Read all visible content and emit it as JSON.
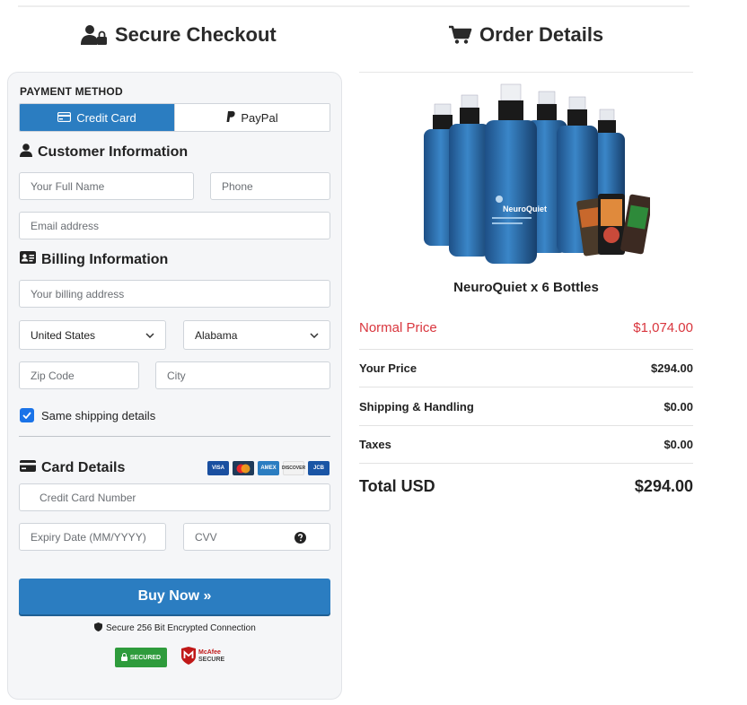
{
  "checkout": {
    "title": "Secure Checkout",
    "payment_method_label": "PAYMENT METHOD",
    "tabs": [
      {
        "label": "Credit Card",
        "icon": "credit-card-icon",
        "active": true
      },
      {
        "label": "PayPal",
        "icon": "paypal-icon",
        "active": false
      }
    ],
    "customer_section": {
      "title": "Customer Information",
      "icon": "user-icon",
      "full_name_placeholder": "Your Full Name",
      "phone_placeholder": "Phone",
      "email_placeholder": "Email address"
    },
    "billing_section": {
      "title": "Billing Information",
      "icon": "id-card-icon",
      "address_placeholder": "Your billing address",
      "country_value": "United States",
      "state_value": "Alabama",
      "zip_placeholder": "Zip Code",
      "city_placeholder": "City",
      "same_shipping_label": "Same shipping details",
      "same_shipping_checked": true
    },
    "card_section": {
      "title": "Card Details",
      "icon": "credit-card-icon",
      "card_logos": [
        "VISA",
        "mastercard",
        "AMEX",
        "DISCOVER",
        "JCB"
      ],
      "card_number_placeholder": "Credit Card Number",
      "expiry_placeholder": "Expiry Date (MM/YYYY)",
      "cvv_placeholder": "CVV"
    },
    "buy_button_label": "Buy Now »",
    "secure_text": "Secure 256 Bit Encrypted Connection",
    "badges": {
      "ssl": "SECURED",
      "mcafee_top": "McAfee",
      "mcafee_bottom": "SECURE"
    }
  },
  "order": {
    "title": "Order Details",
    "product_name": "NeuroQuiet x 6 Bottles",
    "bottle_label": "NeuroQuiet",
    "normal_price_label": "Normal Price",
    "normal_price_value": "$1,074.00",
    "rows": [
      {
        "label": "Your Price",
        "value": "$294.00"
      },
      {
        "label": "Shipping & Handling",
        "value": "$0.00"
      },
      {
        "label": "Taxes",
        "value": "$0.00"
      }
    ],
    "total_label": "Total USD",
    "total_value": "$294.00"
  },
  "colors": {
    "accent": "#2b7dc1",
    "strike_red": "#d9363e",
    "card_bg": "#f5f6f8",
    "checkbox": "#1a73e8"
  }
}
